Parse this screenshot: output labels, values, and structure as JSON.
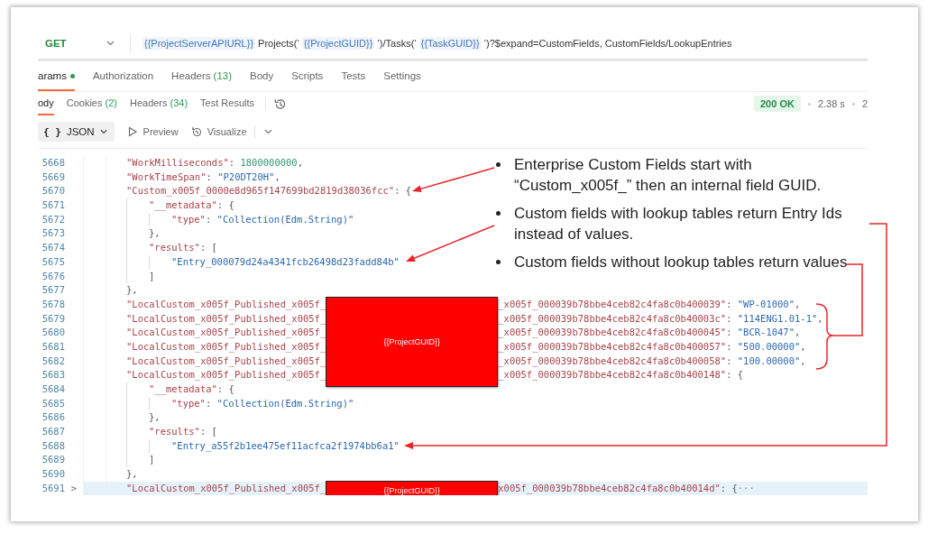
{
  "request": {
    "method": "GET",
    "url": [
      {
        "kind": "variable",
        "text": "{{ProjectServerAPIURL}}"
      },
      {
        "kind": "text",
        "text": "Projects(‘"
      },
      {
        "kind": "variable",
        "text": "{{ProjectGUID}}"
      },
      {
        "kind": "text",
        "text": "’)/Tasks(‘"
      },
      {
        "kind": "variable",
        "text": "{{TaskGUID}}"
      },
      {
        "kind": "text",
        "text": "’)?$expand=CustomFields, CustomFields/LookupEntries"
      }
    ]
  },
  "request_tabs": [
    {
      "label": "arams",
      "indicator": true,
      "selected": true
    },
    {
      "label": "Authorization",
      "indicator": false,
      "selected": false
    },
    {
      "label": "Headers",
      "count": "(13)",
      "indicator": false,
      "selected": false
    },
    {
      "label": "Body",
      "indicator": false,
      "selected": false
    },
    {
      "label": "Scripts",
      "indicator": false,
      "selected": false
    },
    {
      "label": "Tests",
      "indicator": false,
      "selected": false
    },
    {
      "label": "Settings",
      "indicator": false,
      "selected": false
    }
  ],
  "response_tabs": [
    {
      "label": "ody",
      "selected": true
    },
    {
      "label": "Cookies",
      "count": "(2)",
      "selected": false
    },
    {
      "label": "Headers",
      "count": "(34)",
      "selected": false
    },
    {
      "label": "Test Results",
      "selected": false
    }
  ],
  "response_meta": {
    "status": "200 OK",
    "time": "2.38 s",
    "size": "2"
  },
  "toolbar": {
    "format_icon": "{ }",
    "format": "JSON",
    "buttons": [
      {
        "kind": "preview",
        "label": "Preview"
      },
      {
        "kind": "visualize",
        "label": "Visualize"
      }
    ]
  },
  "code_lines": [
    {
      "number": "5668",
      "highlighted": false,
      "parts": [
        {
          "kind": "key",
          "text": "\"WorkMilliseconds\""
        },
        {
          "kind": "punct",
          "text": ": "
        },
        {
          "kind": "number",
          "text": "1800000000"
        },
        {
          "kind": "punct",
          "text": ","
        }
      ]
    },
    {
      "number": "5669",
      "highlighted": false,
      "parts": [
        {
          "kind": "key",
          "text": "\"WorkTimeSpan\""
        },
        {
          "kind": "punct",
          "text": ": "
        },
        {
          "kind": "string",
          "text": "\"P20DT20H\""
        },
        {
          "kind": "punct",
          "text": ","
        }
      ]
    },
    {
      "number": "5670",
      "highlighted": false,
      "parts": [
        {
          "kind": "key",
          "text": "\"Custom_x005f_0000e8d965f147699bd2819d38036fcc\""
        },
        {
          "kind": "punct",
          "text": ": {"
        }
      ],
      "children": [
        {
          "number": "5671",
          "highlighted": false,
          "parts": [
            {
              "kind": "key",
              "text": "\"__metadata\""
            },
            {
              "kind": "punct",
              "text": ": {"
            }
          ],
          "children": [
            {
              "number": "5672",
              "highlighted": false,
              "parts": [
                {
                  "kind": "key",
                  "text": "\"type\""
                },
                {
                  "kind": "punct",
                  "text": ": "
                },
                {
                  "kind": "string",
                  "text": "\"Collection(Edm.String)\""
                }
              ]
            }
          ]
        },
        {
          "number": "5673",
          "highlighted": false,
          "parts": [
            {
              "kind": "punct",
              "text": "},"
            }
          ]
        },
        {
          "number": "5674",
          "highlighted": false,
          "parts": [
            {
              "kind": "key",
              "text": "\"results\""
            },
            {
              "kind": "punct",
              "text": ": ["
            }
          ],
          "children": [
            {
              "number": "5675",
              "highlighted": false,
              "parts": [
                {
                  "kind": "string",
                  "text": "\"Entry_000079d24a4341fcb26498d23fadd84b\""
                }
              ]
            }
          ]
        },
        {
          "number": "5676",
          "highlighted": false,
          "parts": [
            {
              "kind": "punct",
              "text": "]"
            }
          ]
        }
      ]
    },
    {
      "number": "5677",
      "highlighted": false,
      "parts": [
        {
          "kind": "punct",
          "text": "},"
        }
      ]
    },
    {
      "number": "5678",
      "highlighted": false,
      "parts": [
        {
          "kind": "key",
          "text": "\"LocalCustom_x005f_Published_x005f_"
        },
        {
          "kind": "redacted"
        },
        {
          "kind": "key",
          "text": "_x005f_000039b78bbe4ceb82c4fa8c0b400039\""
        },
        {
          "kind": "punct",
          "text": ": "
        },
        {
          "kind": "string",
          "text": "\"WP-01000\""
        },
        {
          "kind": "punct",
          "text": ","
        }
      ]
    },
    {
      "number": "5679",
      "highlighted": false,
      "parts": [
        {
          "kind": "key",
          "text": "\"LocalCustom_x005f_Published_x005f_"
        },
        {
          "kind": "redacted"
        },
        {
          "kind": "key",
          "text": "_x005f_000039b78bbe4ceb82c4fa8c0b40003c\""
        },
        {
          "kind": "punct",
          "text": ": "
        },
        {
          "kind": "string",
          "text": "\"114ENG1.01-1\""
        },
        {
          "kind": "punct",
          "text": ","
        }
      ]
    },
    {
      "number": "5680",
      "highlighted": false,
      "parts": [
        {
          "kind": "key",
          "text": "\"LocalCustom_x005f_Published_x005f_"
        },
        {
          "kind": "redacted"
        },
        {
          "kind": "key",
          "text": "_x005f_000039b78bbe4ceb82c4fa8c0b400045\""
        },
        {
          "kind": "punct",
          "text": ": "
        },
        {
          "kind": "string",
          "text": "\"BCR-1047\""
        },
        {
          "kind": "punct",
          "text": ","
        }
      ]
    },
    {
      "number": "5681",
      "highlighted": false,
      "parts": [
        {
          "kind": "key",
          "text": "\"LocalCustom_x005f_Published_x005f_"
        },
        {
          "kind": "redacted"
        },
        {
          "kind": "key",
          "text": "_x005f_000039b78bbe4ceb82c4fa8c0b400057\""
        },
        {
          "kind": "punct",
          "text": ": "
        },
        {
          "kind": "string",
          "text": "\"500.00000\""
        },
        {
          "kind": "punct",
          "text": ","
        }
      ]
    },
    {
      "number": "5682",
      "highlighted": false,
      "parts": [
        {
          "kind": "key",
          "text": "\"LocalCustom_x005f_Published_x005f_"
        },
        {
          "kind": "redacted"
        },
        {
          "kind": "key",
          "text": "_x005f_000039b78bbe4ceb82c4fa8c0b400058\""
        },
        {
          "kind": "punct",
          "text": ": "
        },
        {
          "kind": "string",
          "text": "\"100.00000\""
        },
        {
          "kind": "punct",
          "text": ","
        }
      ]
    },
    {
      "number": "5683",
      "highlighted": false,
      "parts": [
        {
          "kind": "key",
          "text": "\"LocalCustom_x005f_Published_x005f_"
        },
        {
          "kind": "redacted"
        },
        {
          "kind": "key",
          "text": "_x005f_000039b78bbe4ceb82c4fa8c0b400148\""
        },
        {
          "kind": "punct",
          "text": ": {"
        }
      ],
      "children": [
        {
          "number": "5684",
          "highlighted": false,
          "parts": [
            {
              "kind": "key",
              "text": "\"__metadata\""
            },
            {
              "kind": "punct",
              "text": ": {"
            }
          ],
          "children": [
            {
              "number": "5685",
              "highlighted": false,
              "parts": [
                {
                  "kind": "key",
                  "text": "\"type\""
                },
                {
                  "kind": "punct",
                  "text": ": "
                },
                {
                  "kind": "string",
                  "text": "\"Collection(Edm.String)\""
                }
              ]
            }
          ]
        },
        {
          "number": "5686",
          "highlighted": false,
          "parts": [
            {
              "kind": "punct",
              "text": "},"
            }
          ]
        },
        {
          "number": "5687",
          "highlighted": false,
          "parts": [
            {
              "kind": "key",
              "text": "\"results\""
            },
            {
              "kind": "punct",
              "text": ": ["
            }
          ],
          "children": [
            {
              "number": "5688",
              "highlighted": false,
              "parts": [
                {
                  "kind": "string",
                  "text": "\"Entry_a55f2b1ee475ef11acfca2f1974bb6a1\""
                }
              ]
            }
          ]
        },
        {
          "number": "5689",
          "highlighted": false,
          "parts": [
            {
              "kind": "punct",
              "text": "]"
            }
          ]
        }
      ]
    },
    {
      "number": "5690",
      "highlighted": false,
      "parts": [
        {
          "kind": "punct",
          "text": "},"
        }
      ]
    },
    {
      "number": "5691",
      "highlighted": true,
      "fold": ">",
      "parts": [
        {
          "kind": "key",
          "text": "\"LocalCustom_x005f_Published_x005f_"
        },
        {
          "kind": "redacted"
        },
        {
          "kind": "key",
          "text": "x005f_000039b78bbe4ceb82c4fa8c0b40014d\""
        },
        {
          "kind": "punct",
          "text": ": {"
        },
        {
          "kind": "ellipsis",
          "text": "···"
        }
      ]
    }
  ],
  "redactions": [
    {
      "label": "{{ProjectGUID}}"
    },
    {
      "label": "{{ProjectGUID}}"
    }
  ],
  "notes": [
    {
      "text": "Enterprise Custom Fields start with “Custom_x005f_” then an internal field GUID."
    },
    {
      "text": "Custom fields with lookup tables return Entry Ids instead of values."
    },
    {
      "text": "Custom fields without lookup tables return values"
    }
  ]
}
